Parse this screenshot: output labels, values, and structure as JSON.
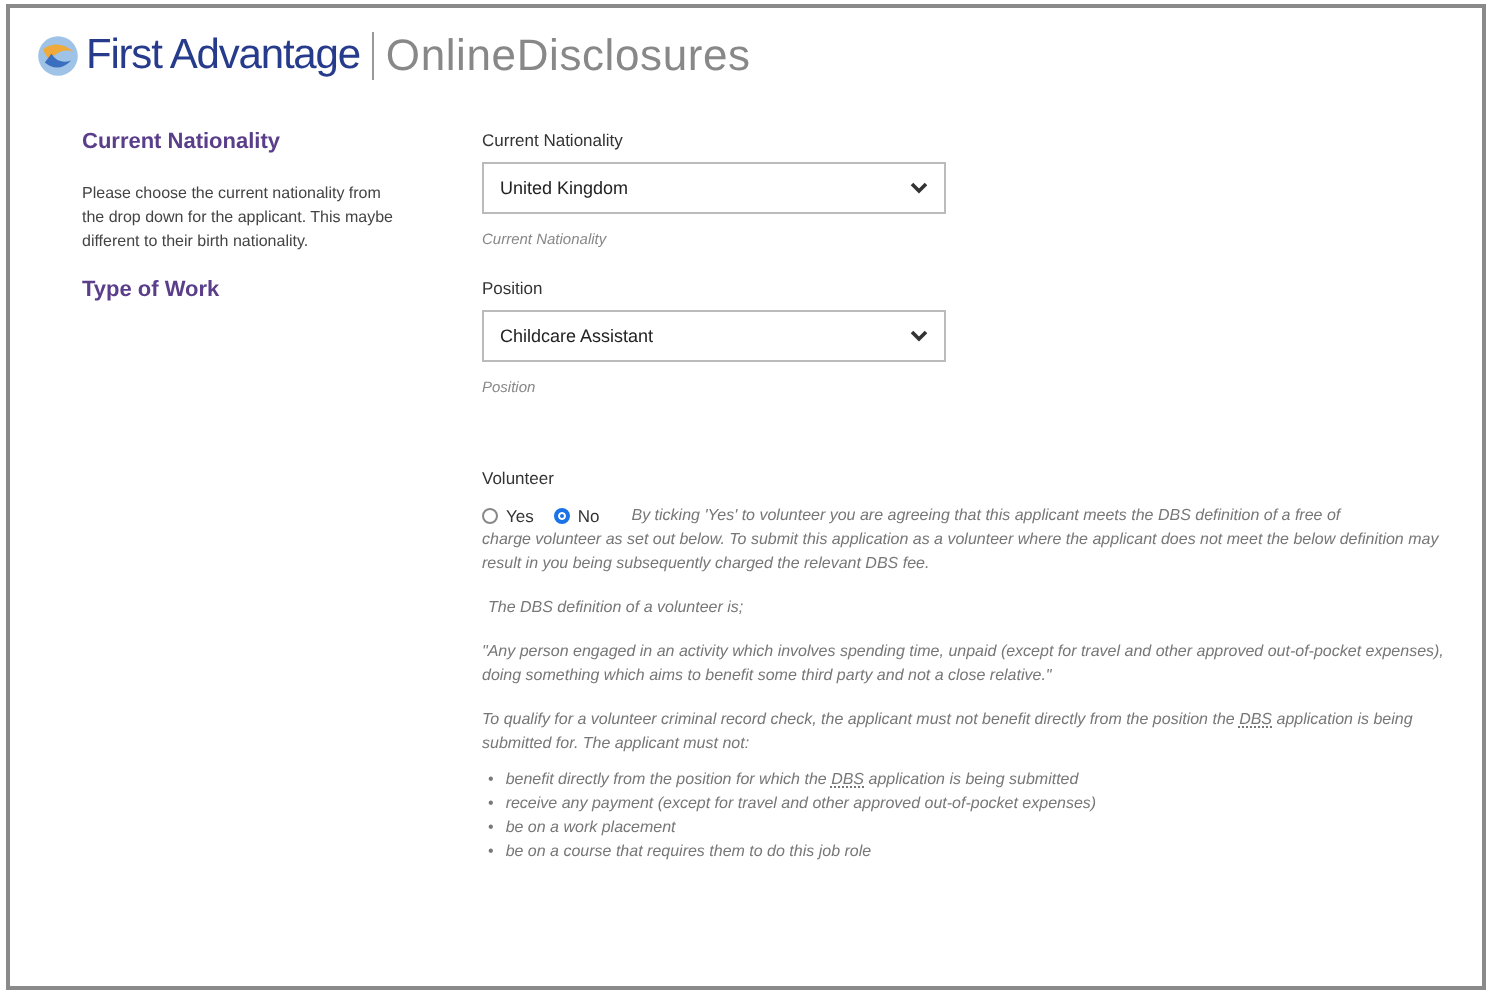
{
  "header": {
    "brand": "First Advantage",
    "product": "OnlineDisclosures"
  },
  "sections": [
    {
      "title": "Current Nationality",
      "description": "Please choose the current nationality from the drop down for the applicant. This maybe different to their birth nationality.",
      "field": {
        "label": "Current Nationality",
        "value": "United Kingdom",
        "help": "Current Nationality"
      }
    },
    {
      "title": "Type of Work",
      "field": {
        "label": "Position",
        "value": "Childcare Assistant",
        "help": "Position"
      }
    }
  ],
  "volunteer": {
    "label": "Volunteer",
    "options": [
      {
        "label": "Yes",
        "selected": false
      },
      {
        "label": "No",
        "selected": true
      }
    ],
    "notice_first_line": "By ticking 'Yes' to volunteer you are agreeing that this applicant meets the DBS definition of a free of",
    "notice_rest": "charge volunteer as set out below. To submit this application as a volunteer where the applicant does not meet the below definition may result in you being subsequently charged the relevant DBS fee.",
    "definition_heading": "The DBS definition of a volunteer is;",
    "definition": "\"Any person engaged in an activity which involves spending time, unpaid (except for travel and other approved out-of-pocket expenses), doing something which aims to benefit some third party and not a close relative.\"",
    "qualify": [
      "To qualify for a volunteer criminal record check, the applicant must not benefit directly from the position the ",
      "DBS",
      " application is being submitted for. The applicant must not:"
    ],
    "rules": [
      {
        "bullet": "•",
        "parts": [
          "benefit directly from the position for which the ",
          "DBS",
          " application is being submitted"
        ]
      },
      {
        "bullet": "•",
        "parts": [
          "receive any payment (except for travel and other approved out-of-pocket expenses)"
        ]
      },
      {
        "bullet": "•",
        "parts": [
          "be on a work placement"
        ]
      },
      {
        "bullet": "•",
        "parts": [
          "be on a course that requires them to do this job role"
        ]
      }
    ]
  }
}
